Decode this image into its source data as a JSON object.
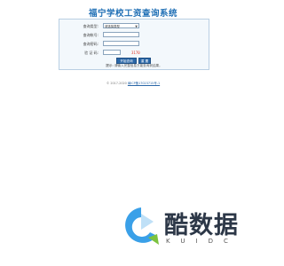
{
  "page": {
    "title": "福宁学校工资查询系统"
  },
  "form": {
    "type_label": "查询类型:",
    "type_value": "请选择类型",
    "account_label": "查询帐号:",
    "password_label": "查询密码:",
    "captcha_label": "验 证 码:",
    "captcha_value": "3170",
    "start_button": "开始查询",
    "reset_button": "重 置",
    "hint_prefix": "提示:",
    "hint_text": "请输入完整信息方能查询到结果。"
  },
  "footer": {
    "copyright": "© 2017-2020",
    "link_text": "闽ICP备17023715号-1"
  },
  "watermark": {
    "wordmark": "酷数据",
    "sub": "KUIDC"
  },
  "colors": {
    "title": "#1f6fb5",
    "button": "#2a67a8",
    "captcha": "#e03a2a",
    "logo_blue": "#3aa0e8",
    "logo_green": "#7cc23f"
  }
}
